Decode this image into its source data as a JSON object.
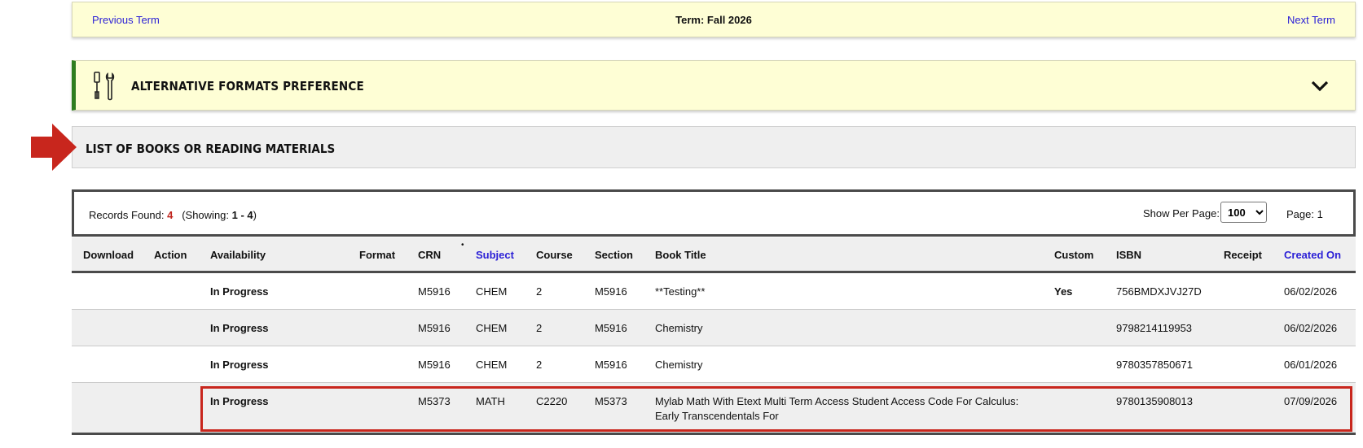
{
  "term_nav": {
    "previous": "Previous Term",
    "current": "Term: Fall 2026",
    "next": "Next Term"
  },
  "alt_formats": {
    "title": "ALTERNATIVE FORMATS PREFERENCE",
    "icon": "tools-icon",
    "toggle_icon": "chevron-down-icon"
  },
  "books_section": {
    "title": "LIST OF BOOKS OR READING MATERIALS"
  },
  "records": {
    "found_label": "Records Found:",
    "found_count": "4",
    "showing_open": "(Showing:",
    "showing_range": "1 - 4",
    "showing_close": ")",
    "per_page_label": "Show Per Page:",
    "per_page_value": "100",
    "page_label": "Page: 1"
  },
  "table": {
    "sort_marker": "•",
    "headers": {
      "download": "Download",
      "action": "Action",
      "availability": "Availability",
      "format": "Format",
      "crn": "CRN",
      "subject": "Subject",
      "course": "Course",
      "section": "Section",
      "book_title": "Book Title",
      "custom": "Custom",
      "isbn": "ISBN",
      "receipt": "Receipt",
      "created_on": "Created On"
    },
    "rows": [
      {
        "availability": "In Progress",
        "crn": "M5916",
        "subject": "CHEM",
        "course": "2",
        "section": "M5916",
        "title": "**Testing**",
        "custom": "Yes",
        "isbn": "756BMDXJVJ27D",
        "created_on": "06/02/2026"
      },
      {
        "availability": "In Progress",
        "crn": "M5916",
        "subject": "CHEM",
        "course": "2",
        "section": "M5916",
        "title": "Chemistry",
        "custom": "",
        "isbn": "9798214119953",
        "created_on": "06/02/2026"
      },
      {
        "availability": "In Progress",
        "crn": "M5916",
        "subject": "CHEM",
        "course": "2",
        "section": "M5916",
        "title": "Chemistry",
        "custom": "",
        "isbn": "9780357850671",
        "created_on": "06/01/2026"
      },
      {
        "availability": "In Progress",
        "crn": "M5373",
        "subject": "MATH",
        "course": "C2220",
        "section": "M5373",
        "title": "Mylab Math With Etext Multi Term Access Student Access Code For Calculus: Early Transcendentals For",
        "custom": "",
        "isbn": "9780135908013",
        "created_on": "07/09/2026"
      }
    ]
  },
  "colors": {
    "accent_link": "#2a1fd6",
    "highlight": "#c8261d",
    "alt_border": "#2e7d1f",
    "term_bg": "#fefed5"
  }
}
